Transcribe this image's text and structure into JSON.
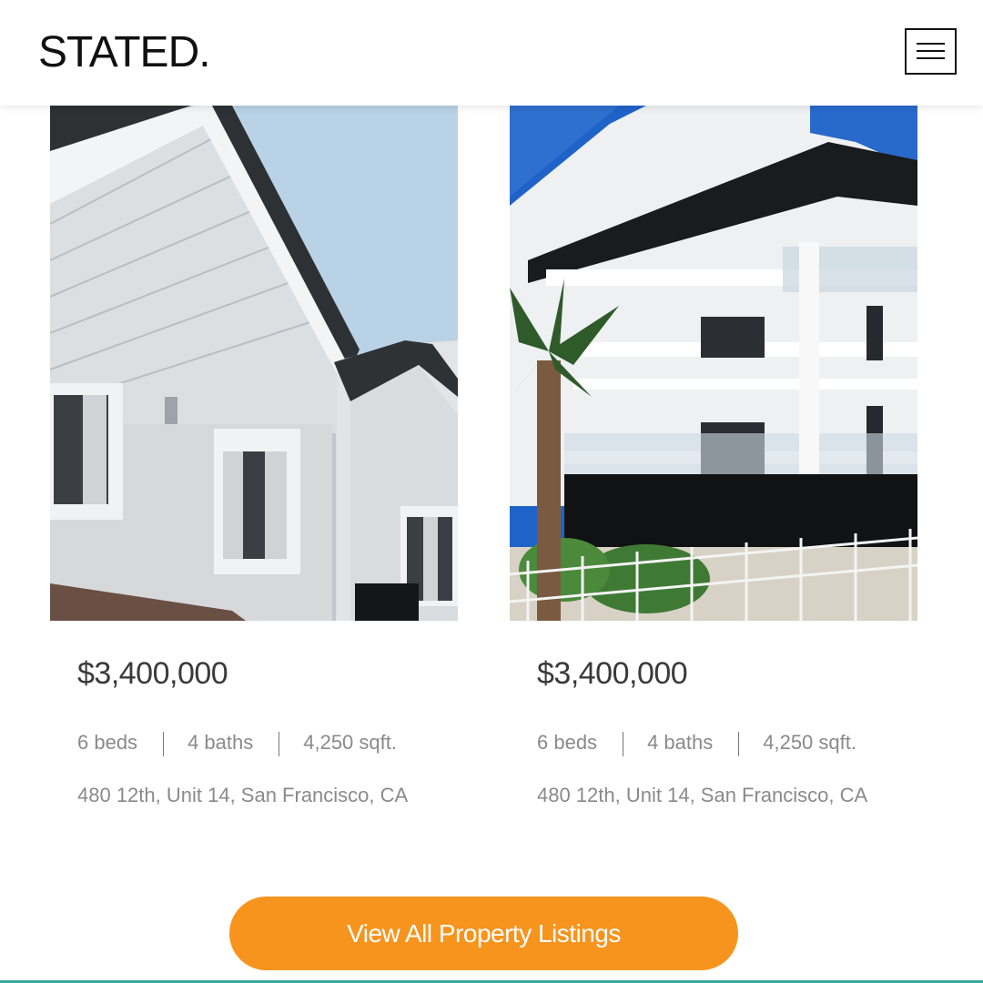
{
  "header": {
    "logo": "STATED.",
    "menu_icon": "hamburger-menu-icon"
  },
  "listings": [
    {
      "photo": "white-gabled-house-photo",
      "price": "$3,400,000",
      "beds": "6 beds",
      "baths": "4 baths",
      "sqft": "4,250 sqft.",
      "address": "480 12th, Unit 14, San Francisco, CA"
    },
    {
      "photo": "modern-white-apartment-building-photo",
      "price": "$3,400,000",
      "beds": "6 beds",
      "baths": "4 baths",
      "sqft": "4,250 sqft.",
      "address": "480 12th, Unit 14, San Francisco, CA"
    }
  ],
  "cta": {
    "label": "View All Property Listings"
  },
  "colors": {
    "accent": "#f7941d",
    "price_text": "#3a3a3a",
    "muted_text": "#8a8a8a",
    "bottom_line": "#3aa89a"
  }
}
